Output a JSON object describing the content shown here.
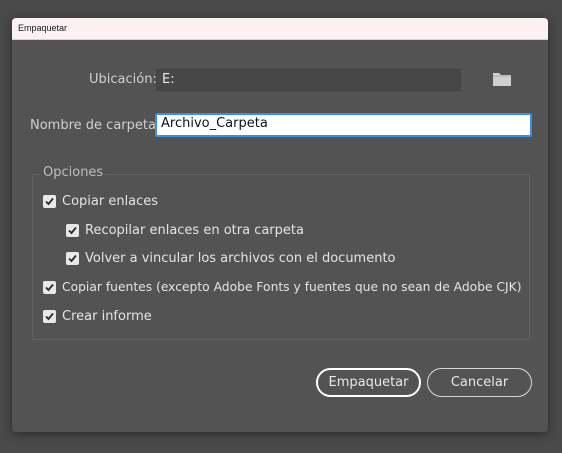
{
  "dialog": {
    "title": "Empaquetar"
  },
  "location": {
    "label": "Ubicación:",
    "value": "E:"
  },
  "folder_name": {
    "label": "Nombre de carpeta:",
    "value": "Archivo_Carpeta"
  },
  "options": {
    "title": "Opciones",
    "items": [
      {
        "label": "Copiar enlaces",
        "checked": true
      },
      {
        "label": "Recopilar enlaces en otra carpeta",
        "checked": true
      },
      {
        "label": "Volver a vincular los archivos con el documento",
        "checked": true
      },
      {
        "label": "Copiar fuentes (excepto Adobe Fonts y fuentes que no sean de Adobe CJK)",
        "checked": true
      },
      {
        "label": "Crear informe",
        "checked": true
      }
    ]
  },
  "buttons": {
    "package_label": "Empaquetar",
    "cancel_label": "Cancelar"
  },
  "icons": {
    "browse": "folder-icon",
    "checkbox": "checkmark-icon"
  },
  "colors": {
    "dialog_bg": "#535353",
    "titlebar_bg": "#fbf0f2",
    "focus_border": "#3b8ee8"
  }
}
